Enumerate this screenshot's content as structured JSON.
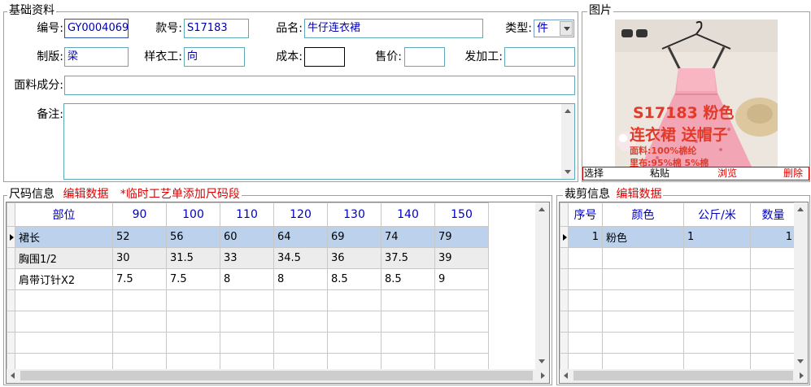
{
  "basic": {
    "title": "基础资料",
    "code_label": "编号:",
    "code_value": "GY0004069",
    "style_no_label": "款号:",
    "style_no_value": "S17183",
    "product_name_label": "品名:",
    "product_name_value": "牛仔连衣裙",
    "type_label": "类型:",
    "type_value": "件",
    "pattern_label": "制版:",
    "pattern_value": "梁",
    "sample_worker_label": "样衣工:",
    "sample_worker_value": "向",
    "cost_label": "成本:",
    "cost_value": "",
    "price_label": "售价:",
    "price_value": "",
    "processor_label": "发加工:",
    "processor_value": "",
    "fabric_label": "面料成分:",
    "fabric_value": "",
    "note_label": "备注:",
    "note_value": ""
  },
  "image": {
    "title": "图片",
    "caption_line1": "S17183 粉色",
    "caption_line2": "连衣裙  送帽子",
    "caption_line3": "面料:100%棉纶",
    "caption_line4": "里布:95%棉 5%棉",
    "btn_select": "选择",
    "btn_paste": "粘贴",
    "btn_browse": "浏览",
    "btn_delete": "删除"
  },
  "size_info": {
    "title": "尺码信息",
    "edit_link": "编辑数据",
    "add_size_link": "*临时工艺单添加尺码段",
    "columns": [
      "部位",
      "90",
      "100",
      "110",
      "120",
      "130",
      "140",
      "150"
    ],
    "rows": [
      [
        "裙长",
        "52",
        "56",
        "60",
        "64",
        "69",
        "74",
        "79"
      ],
      [
        "胸围1/2",
        "30",
        "31.5",
        "33",
        "34.5",
        "36",
        "37.5",
        "39"
      ],
      [
        "肩带订针X2",
        "7.5",
        "7.5",
        "8",
        "8",
        "8.5",
        "8.5",
        "9"
      ]
    ]
  },
  "cutting_info": {
    "title": "裁剪信息",
    "edit_link": "编辑数据",
    "columns": [
      "序号",
      "颜色",
      "公斤/米",
      "数量"
    ],
    "rows": [
      [
        "1",
        "粉色",
        "1",
        "1"
      ]
    ]
  }
}
